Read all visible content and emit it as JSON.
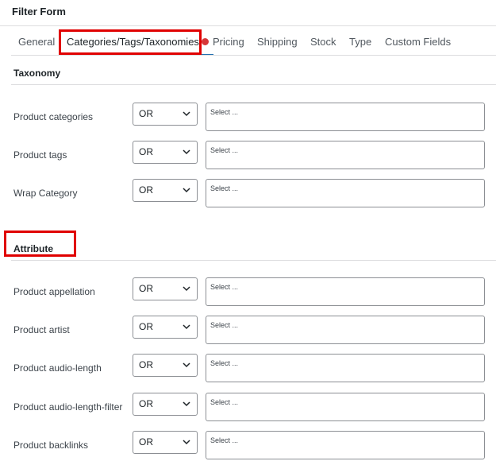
{
  "panel": {
    "title": "Filter Form"
  },
  "tabs": [
    {
      "label": "General"
    },
    {
      "label": "Categories/Tags/Taxonomies"
    },
    {
      "label": "Pricing"
    },
    {
      "label": "Shipping"
    },
    {
      "label": "Stock"
    },
    {
      "label": "Type"
    },
    {
      "label": "Custom Fields"
    }
  ],
  "active_tab": "Categories/Tags/Taxonomies",
  "colors": {
    "accent": "#2271b1",
    "highlight": "#e00000",
    "dot": "#d63638"
  },
  "taxonomy": {
    "heading": "Taxonomy",
    "rows": [
      {
        "label": "Product categories",
        "operator": "OR",
        "placeholder": "Select ..."
      },
      {
        "label": "Product tags",
        "operator": "OR",
        "placeholder": "Select ..."
      },
      {
        "label": "Wrap Category",
        "operator": "OR",
        "placeholder": "Select ..."
      }
    ]
  },
  "attribute": {
    "heading": "Attribute",
    "rows": [
      {
        "label": "Product appellation",
        "operator": "OR",
        "placeholder": "Select ..."
      },
      {
        "label": "Product artist",
        "operator": "OR",
        "placeholder": "Select ..."
      },
      {
        "label": "Product audio-length",
        "operator": "OR",
        "placeholder": "Select ..."
      },
      {
        "label": "Product audio-length-filter",
        "operator": "OR",
        "placeholder": "Select ..."
      },
      {
        "label": "Product backlinks",
        "operator": "OR",
        "placeholder": "Select ..."
      }
    ]
  }
}
